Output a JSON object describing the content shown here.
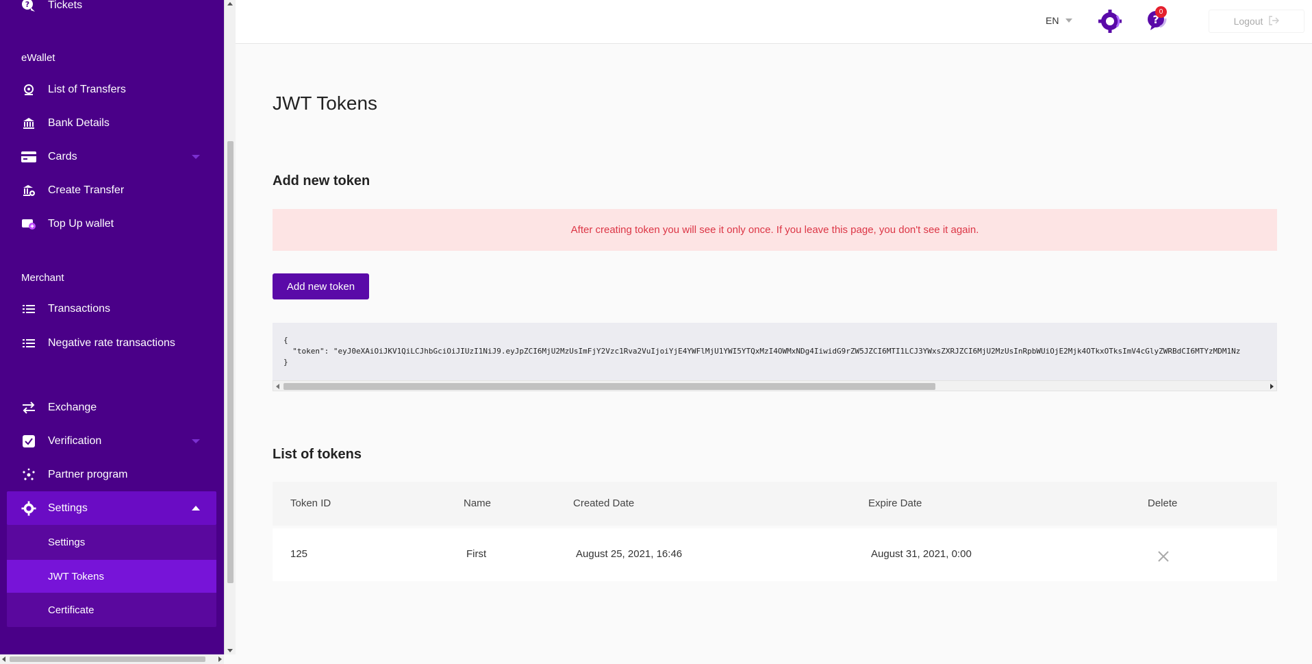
{
  "sidebar": {
    "top_item": {
      "label": "Tickets",
      "icon": "help-chat-icon"
    },
    "sections": {
      "ewallet": "eWallet",
      "merchant": "Merchant"
    },
    "ewallet_items": [
      {
        "label": "List of Transfers",
        "icon": "transfers-list-icon"
      },
      {
        "label": "Bank Details",
        "icon": "bank-icon"
      },
      {
        "label": "Cards",
        "icon": "card-icon"
      },
      {
        "label": "Create Transfer",
        "icon": "create-transfer-icon"
      },
      {
        "label": "Top Up wallet",
        "icon": "wallet-plus-icon"
      }
    ],
    "merchant_items": [
      {
        "label": "Transactions",
        "icon": "list-icon"
      },
      {
        "label": "Negative rate transactions",
        "icon": "list-icon"
      }
    ],
    "other_items": [
      {
        "label": "Exchange",
        "icon": "exchange-arrows-icon"
      },
      {
        "label": "Verification",
        "icon": "checkbox-icon"
      },
      {
        "label": "Partner program",
        "icon": "network-icon"
      },
      {
        "label": "Settings",
        "icon": "gear-icon"
      }
    ],
    "settings_sub": [
      {
        "label": "Settings"
      },
      {
        "label": "JWT Tokens"
      },
      {
        "label": "Certificate"
      }
    ]
  },
  "header": {
    "language": "EN",
    "notifications_count": "0",
    "logout_label": "Logout"
  },
  "main": {
    "title": "JWT Tokens",
    "add_section_title": "Add new token",
    "alert_text": "After creating token you will see it only once. If you leave this page, you don't see it again.",
    "add_button_label": "Add new token",
    "token_json_open": "{",
    "token_json_line": "  \"token\": \"eyJ0eXAiOiJKV1QiLCJhbGciOiJIUzI1NiJ9.eyJpZCI6MjU2MzUsImFjY2Vzc1Rva2VuIjoiYjE4YWFlMjU1YWI5YTQxMzI4OWMxNDg4IiwidG9rZW5JZCI6MTI1LCJ3YWxsZXRJZCI6MjU2MzUsInRpbWUiOjE2Mjk4OTkxOTksImV4cGlyZWRBdCI6MTYzMDM1Nz",
    "token_json_close": "}",
    "list_title": "List of tokens",
    "table": {
      "columns": [
        "Token ID",
        "Name",
        "Created Date",
        "Expire Date",
        "Delete"
      ],
      "rows": [
        {
          "id": "125",
          "name": "First",
          "created": "August 25, 2021, 16:46",
          "expires": "August 31, 2021, 0:00"
        }
      ]
    }
  },
  "colors": {
    "sidebar_bg": "#4a0088",
    "accent": "#5a0aa8",
    "alert_bg": "#fde4e4",
    "alert_text": "#dc3545"
  }
}
